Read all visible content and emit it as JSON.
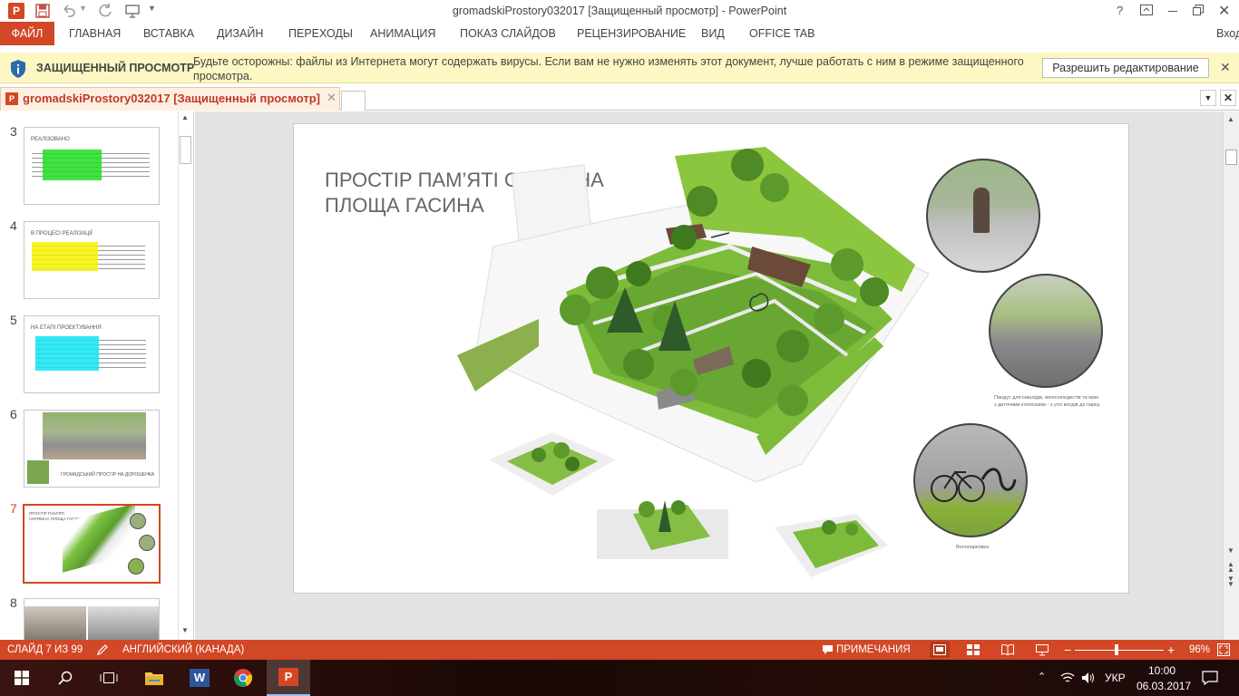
{
  "app": {
    "title": "gromadskiProstory032017 [Защищенный просмотр] - PowerPoint",
    "help": "?",
    "login": "Вход"
  },
  "ribbon": {
    "file_tab": "ФАЙЛ",
    "tabs": [
      "ГЛАВНАЯ",
      "ВСТАВКА",
      "ДИЗАЙН",
      "ПЕРЕХОДЫ",
      "АНИМАЦИЯ",
      "ПОКАЗ СЛАЙДОВ",
      "РЕЦЕНЗИРОВАНИЕ",
      "ВИД",
      "OFFICE TAB"
    ]
  },
  "infobar": {
    "title": "ЗАЩИЩЕННЫЙ ПРОСМОТР",
    "line1": "Будьте осторожны: файлы из Интернета могут содержать вирусы. Если вам не нужно изменять этот документ, лучше работать с ним в режиме защищенного",
    "line2": "просмотра.",
    "button": "Разрешить редактирование"
  },
  "doctab": {
    "label": "gromadskiProstory032017 [Защищенный просмотр]"
  },
  "thumbnails": [
    {
      "num": "3",
      "title": "РЕАЛІЗОВАНО"
    },
    {
      "num": "4",
      "title": "В ПРОЦЕСІ РЕАЛІЗАЦІЇ"
    },
    {
      "num": "5",
      "title": "НА ЕТАПІ ПРОЕКТУВАННЯ"
    },
    {
      "num": "6",
      "title": "ГРОМАДСЬКИЙ ПРОСТІР НА ДОРОШЕНКА"
    },
    {
      "num": "7",
      "title": "ПРОСТІР ПАМ’ЯТІ СКРЯБІНА ПЛОЩА ГАСИНА"
    },
    {
      "num": "8",
      "title": ""
    }
  ],
  "slide": {
    "title_line1": "ПРОСТІР ПАМ’ЯТІ СКРЯБІНА",
    "title_line2": "ПЛОЩА ГАСИНА",
    "caption1_line1": "Пандус для інвалідів, велосипедистів та мам",
    "caption1_line2": "з дитячими колясками - з усіх входів до парку.",
    "caption2": "Велопарковка"
  },
  "statusbar": {
    "slide_info": "СЛАЙД 7 ИЗ 99",
    "language": "АНГЛИЙСКИЙ (КАНАДА)",
    "notes": "ПРИМЕЧАНИЯ",
    "zoom": "96%",
    "zoom_fraction": 0.54
  },
  "taskbar": {
    "lang": "УКР",
    "time": "10:00",
    "date": "06.03.2017"
  },
  "colors": {
    "accent": "#d24726",
    "infobar": "#fdf7c3",
    "green": "#7cc242"
  }
}
